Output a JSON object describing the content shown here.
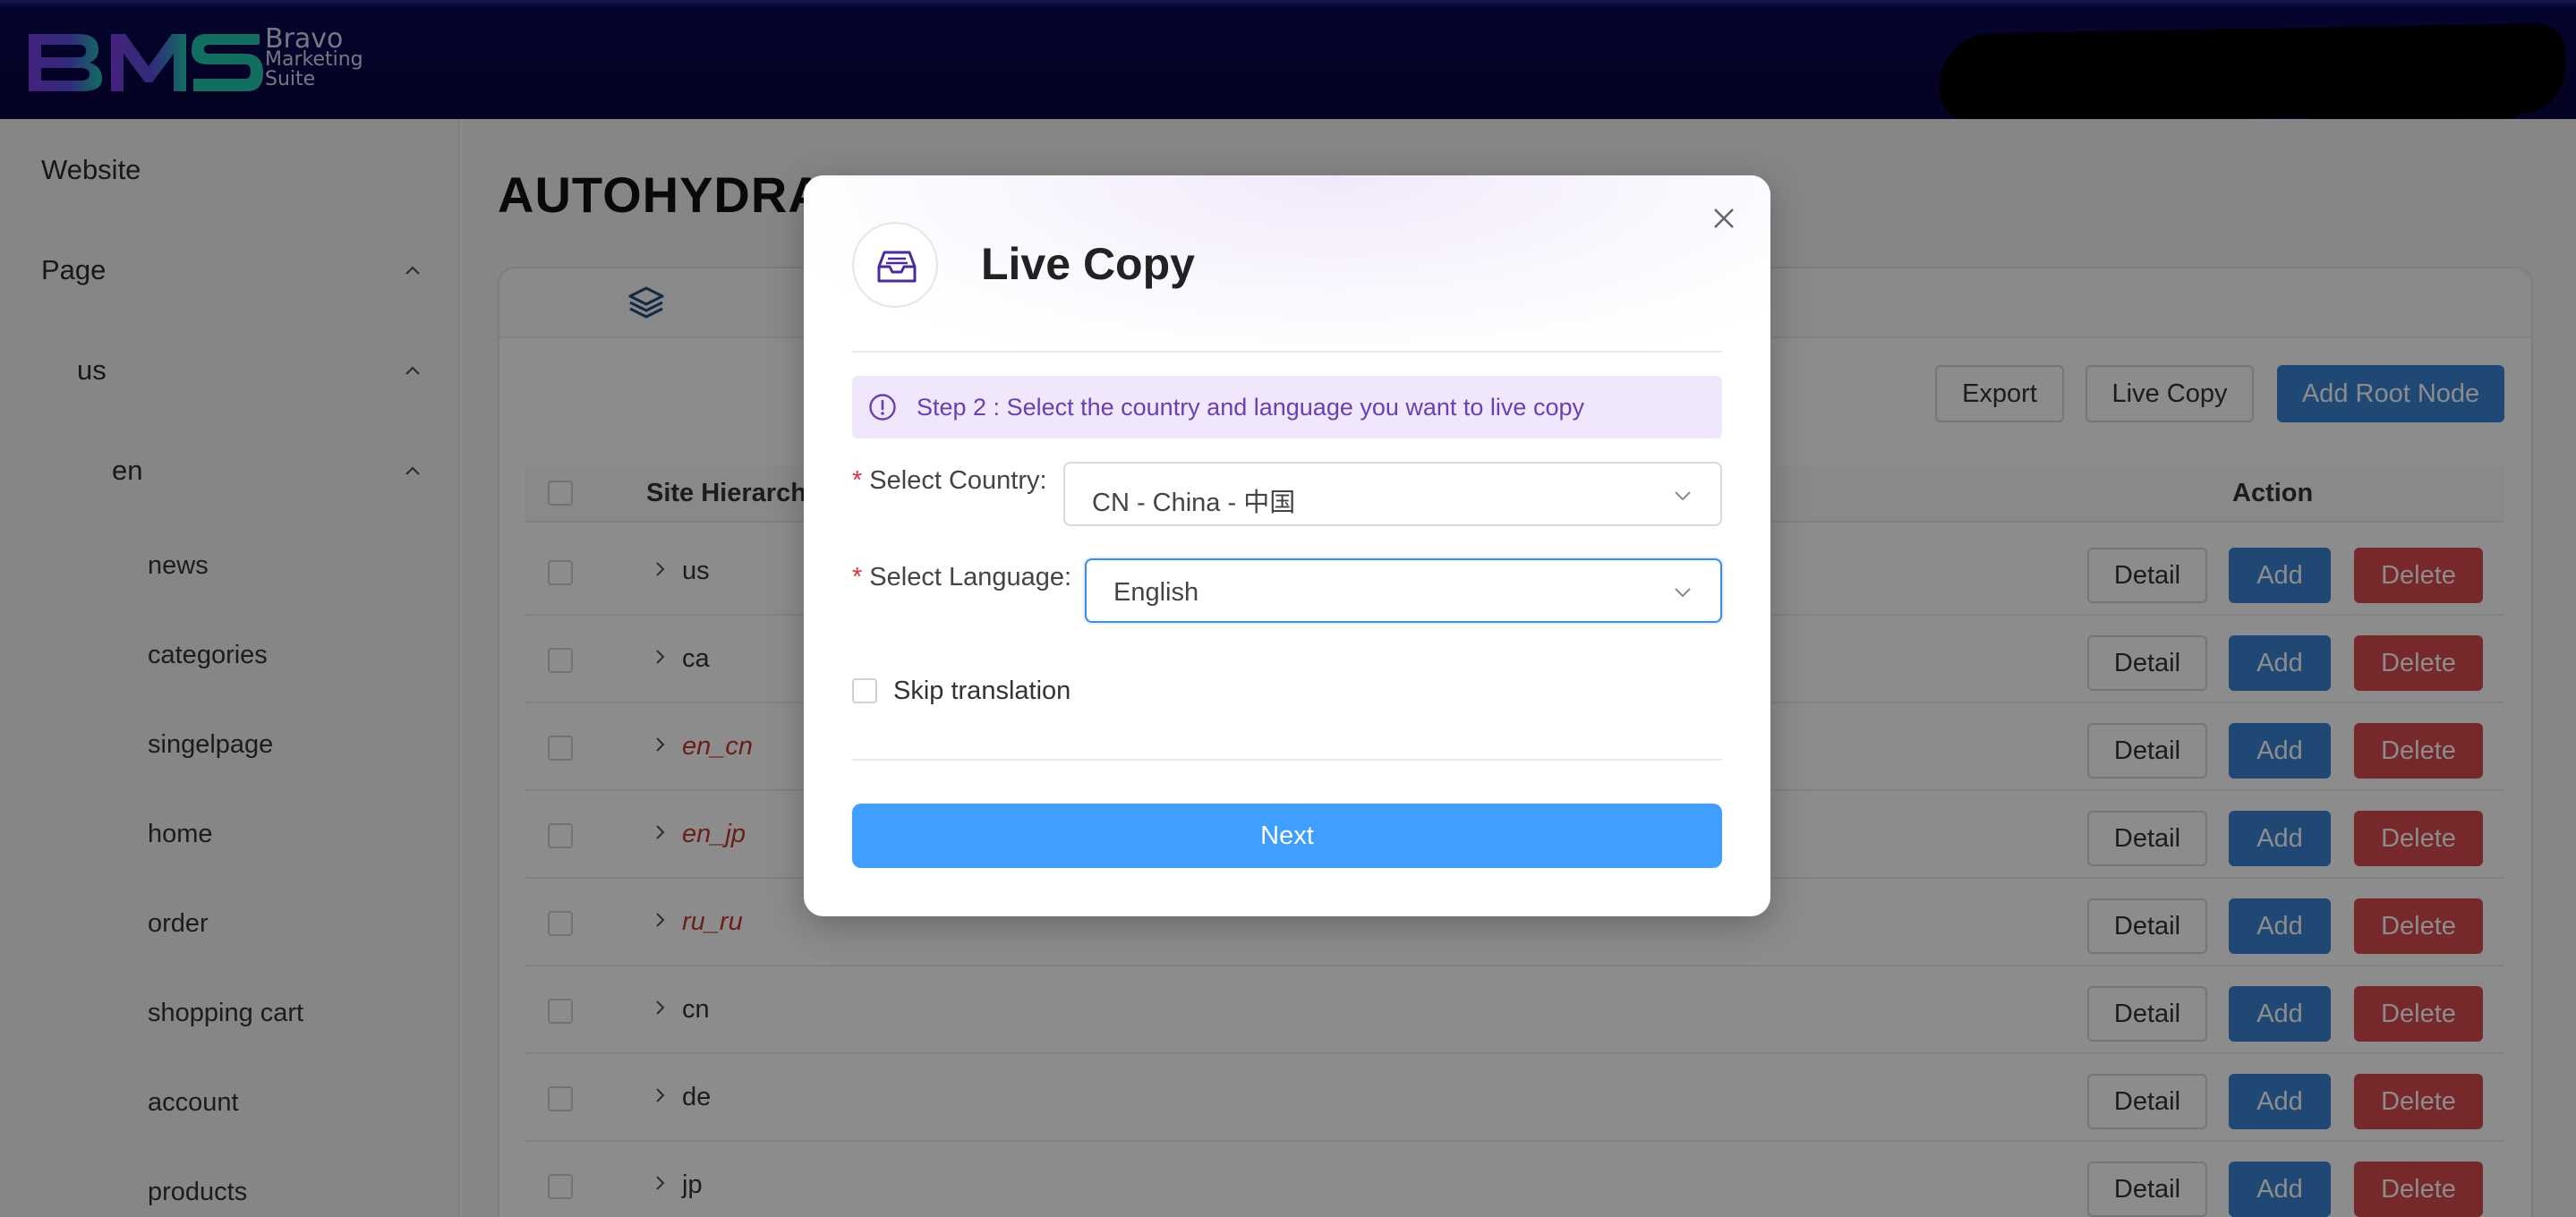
{
  "brand": {
    "logo_mark": "BMS",
    "logo_line1": "Bravo",
    "logo_line2": "Marketing",
    "logo_line3": "Suite"
  },
  "sidebar": {
    "website": "Website",
    "page": "Page",
    "country": "us",
    "language": "en",
    "items": [
      "news",
      "categories",
      "singelpage",
      "home",
      "order",
      "shopping cart",
      "account",
      "products"
    ]
  },
  "main": {
    "title": "AUTOHYDRA",
    "toolbar": {
      "export": "Export",
      "live_copy": "Live Copy",
      "add_root_node": "Add Root Node"
    },
    "table": {
      "headers": {
        "hierarchy": "Site Hierarchy",
        "action": "Action"
      },
      "rows": [
        {
          "name": "us",
          "highlight": false
        },
        {
          "name": "ca",
          "highlight": false
        },
        {
          "name": "en_cn",
          "highlight": true
        },
        {
          "name": "en_jp",
          "highlight": true
        },
        {
          "name": "ru_ru",
          "highlight": true
        },
        {
          "name": "cn",
          "highlight": false
        },
        {
          "name": "de",
          "highlight": false
        },
        {
          "name": "jp",
          "highlight": false
        }
      ],
      "actions": {
        "detail": "Detail",
        "add": "Add",
        "delete": "Delete"
      }
    }
  },
  "modal": {
    "title": "Live Copy",
    "alert": "Step 2 : Select the country and language you want to live copy",
    "country_label": "Select Country:",
    "country_value": "CN - China - 中国",
    "language_label": "Select Language:",
    "language_value": "English",
    "skip_label": "Skip translation",
    "skip_checked": false,
    "next": "Next"
  },
  "colors": {
    "header_bg": "#07063f",
    "primary": "#3a86d4",
    "next_button": "#409eff",
    "danger": "#d94a4f",
    "alert_bg": "#f1e7fc",
    "alert_text": "#6a3fb4",
    "logo_purple": "#7b3fe4",
    "logo_teal": "#1fc8b0"
  }
}
